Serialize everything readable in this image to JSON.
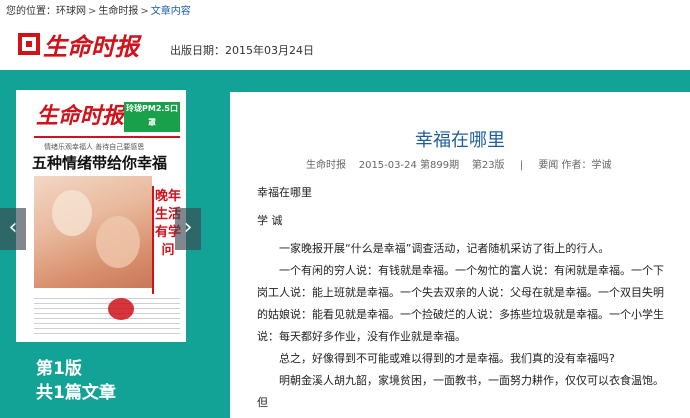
{
  "breadcrumb": {
    "prefix": "您的位置：",
    "items": [
      "环球网",
      "生命时报",
      "文章内容"
    ],
    "separator": ">"
  },
  "header": {
    "logo_text": "生命时报",
    "pub_date": "出版日期：2015年03月24日"
  },
  "paper_preview": {
    "masthead": "生命时报",
    "ad_text": "玲珑PM2.5口罩",
    "sub_line": "情绪乐观幸福人 善待自己要感恩",
    "headline": "五种情绪带给你幸福",
    "side_headline": "晚年生活有学问"
  },
  "nav": {
    "prev_icon": "‹",
    "next_icon": "›"
  },
  "edition": {
    "page": "第1版",
    "count": "共1篇文章"
  },
  "article": {
    "title": "幸福在哪里",
    "meta_source": "生命时报",
    "meta_date": "2015-03-24 第899期",
    "meta_page": "第23版",
    "meta_sep": "|",
    "meta_section": "要闻 作者：学诚",
    "paragraphs": [
      "幸福在哪里",
      "学  诚",
      "一家晚报开展“什么是幸福”调查活动，记者随机采访了街上的行人。",
      "一个有闲的穷人说：有钱就是幸福。一个匆忙的富人说：有闲就是幸福。一个下岗工人说：能上班就是幸福。一个失去双亲的人说：父母在就是幸福。一个双目失明的姑娘说：能看见就是幸福。一个捡破烂的人说：多拣些垃圾就是幸福。一个小学生说：每天都好多作业，没有作业就是幸福。",
      "总之，好像得到不可能或难以得到的才是幸福。我们真的没有幸福吗?",
      "明朝金溪人胡九韶，家境贫困，一面教书，一面努力耕作，仅仅可以衣食温饱。但"
    ]
  },
  "colors": {
    "accent_red": "#d0121b",
    "teal": "#12a396",
    "link_blue": "#1f5e9c"
  }
}
